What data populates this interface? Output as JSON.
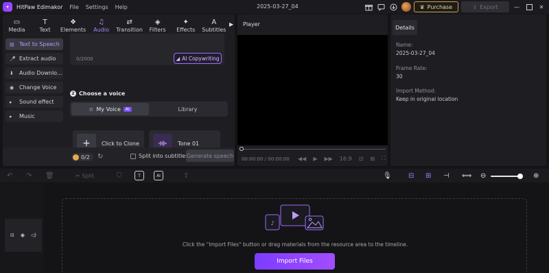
{
  "app": {
    "name": "HitPaw Edimakor",
    "menu": [
      "File",
      "Settings",
      "Help"
    ],
    "doc_title": "2025-03-27_04",
    "purchase_label": "Purchase",
    "export_label": "Export"
  },
  "tabs": [
    {
      "label": "Media",
      "icon": "media-icon",
      "glyph": "▭"
    },
    {
      "label": "Text",
      "icon": "text-icon",
      "glyph": "T"
    },
    {
      "label": "Elements",
      "icon": "elements-icon",
      "glyph": "❖"
    },
    {
      "label": "Audio",
      "icon": "music-note-icon",
      "glyph": "♫"
    },
    {
      "label": "Transition",
      "icon": "transition-icon",
      "glyph": "⇄"
    },
    {
      "label": "Filters",
      "icon": "filters-icon",
      "glyph": "◈"
    },
    {
      "label": "Effects",
      "icon": "effects-icon",
      "glyph": "✦"
    },
    {
      "label": "Subtitles",
      "icon": "subtitles-icon",
      "glyph": "A"
    }
  ],
  "active_tab": "Audio",
  "sidebar": [
    {
      "label": "Text to Speech",
      "glyph": "▤",
      "active": true
    },
    {
      "label": "Extract audio",
      "glyph": "🎤",
      "active": false
    },
    {
      "label": "Audio Downlo...",
      "glyph": "⬇",
      "active": false
    },
    {
      "label": "Change Voice",
      "glyph": "◉",
      "active": false
    },
    {
      "label": "Sound effect",
      "glyph": "▸",
      "active": false
    },
    {
      "label": "Music",
      "glyph": "▸",
      "active": false
    }
  ],
  "tts": {
    "counter": "0/2000",
    "copywriting_label": "AI Copywriting",
    "choose_voice_step": "2",
    "choose_voice_label": "Choose a voice",
    "voice_tabs": [
      "My Voice",
      "Library"
    ],
    "ai_badge": "AI",
    "clone_label": "Click to Clone",
    "tone_label": "Tone 01",
    "credits": "0/2",
    "split_label": "Split into subtitles",
    "generate_label": "Generate speech"
  },
  "player": {
    "title": "Player",
    "time": "00:00:00 / 00:00:00",
    "ratio": "16:9"
  },
  "details": {
    "tab": "Details",
    "name_label": "Name:",
    "name_value": "2025-03-27_04",
    "frame_rate_label": "Frame Rate:",
    "frame_rate_value": "30",
    "import_method_label": "Import Method:",
    "import_method_value": "Keep in original location"
  },
  "timeline": {
    "split_label": "Split",
    "hint": "Click the \"Import Files\" button or drag materials from the resource area to the timeline.",
    "import_label": "Import Files",
    "zoom_level": 0.9
  }
}
